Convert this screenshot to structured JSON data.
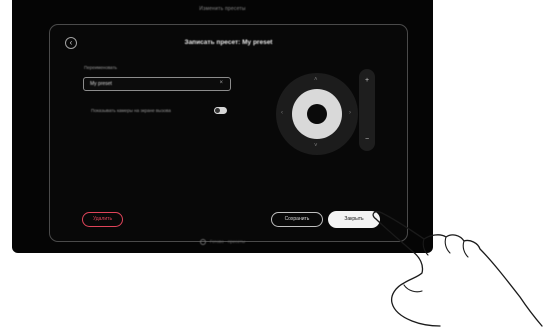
{
  "device": {
    "title": "Изменить пресеты",
    "footer_status": "Готово · пресеты"
  },
  "dialog": {
    "back_icon": "back-arrow-icon",
    "title": "Записать пресет: My preset",
    "name_label": "Переименовать",
    "name_value": "My preset",
    "toggle_label": "Показывать камеры на экране вызова",
    "toggle_on": true,
    "delete_label": "Удалить",
    "cancel_label": "Сохранить",
    "save_label": "Закрыть"
  },
  "colors": {
    "background": "#050505",
    "delete_accent": "#e0445a",
    "primary_button": "#f4f4f4"
  }
}
